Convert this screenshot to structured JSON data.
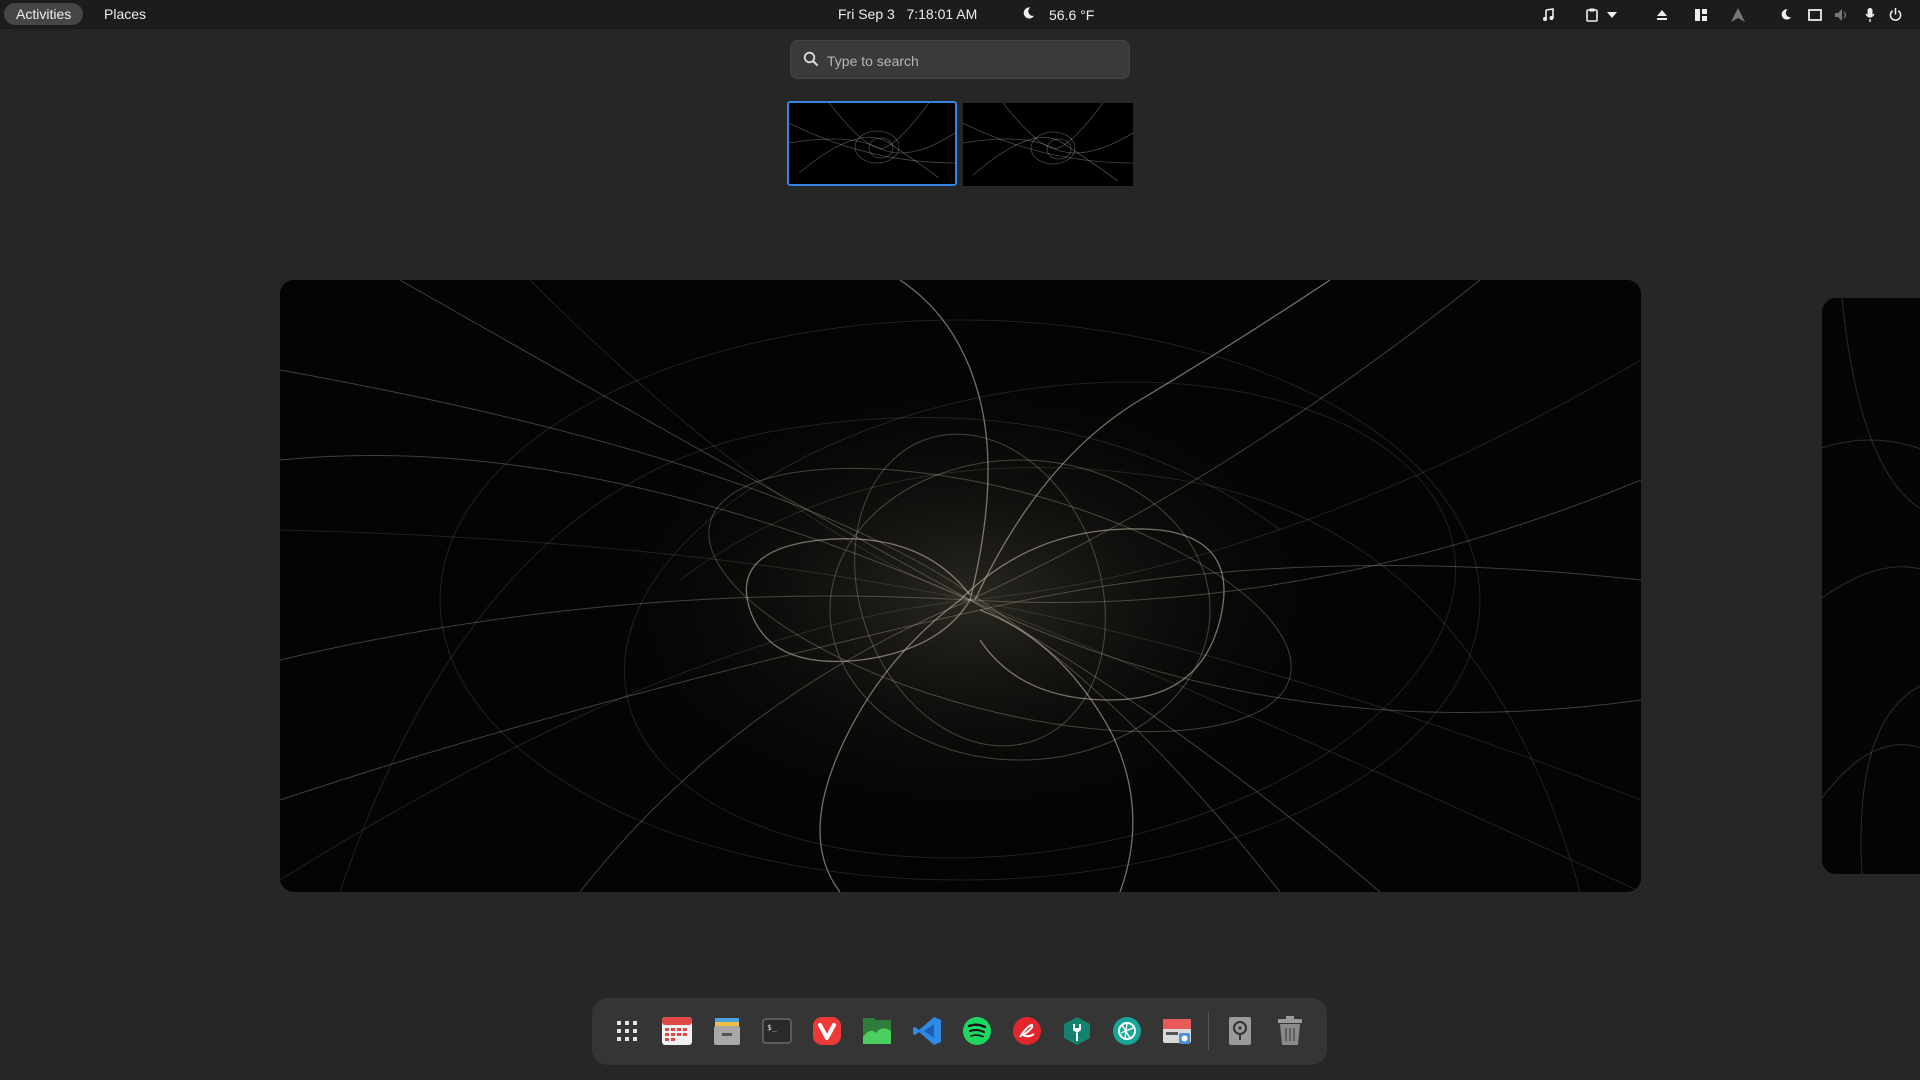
{
  "topbar": {
    "activities_label": "Activities",
    "places_label": "Places",
    "clock": "Fri Sep 3   7:18:01 AM",
    "weather_temp": "56.6 °F",
    "weather_icon": "moon-icon",
    "tray_icons": [
      "music-note-icon",
      "clipboard-icon",
      "dropdown-arrow-icon",
      "eject-icon",
      "grid-layout-icon",
      "arch-logo-icon",
      "night-light-icon",
      "screen-icon",
      "volume-muted-icon",
      "microphone-icon",
      "power-icon"
    ]
  },
  "search": {
    "placeholder": "Type to search"
  },
  "workspaces": {
    "active_index": 0,
    "count": 2,
    "accent": "#3584e4"
  },
  "dash": {
    "apps": [
      {
        "name": "show-apps-icon",
        "color": "#e6e6e6"
      },
      {
        "name": "calendar-app-icon",
        "color": "#e04848"
      },
      {
        "name": "file-manager-icon",
        "color": "#a8a8a8"
      },
      {
        "name": "terminal-icon",
        "color": "#2a2a2a"
      },
      {
        "name": "vivaldi-browser-icon",
        "color": "#ef3939"
      },
      {
        "name": "image-viewer-icon",
        "color": "#3bb54a"
      },
      {
        "name": "vscode-icon",
        "color": "#2f8ae6"
      },
      {
        "name": "spotify-icon",
        "color": "#1ed760"
      },
      {
        "name": "acrobat-icon",
        "color": "#e3262d"
      },
      {
        "name": "dev-tools-icon",
        "color": "#14806e"
      },
      {
        "name": "aperture-app-icon",
        "color": "#18a698"
      },
      {
        "name": "screenshot-app-icon",
        "color": "#e85a5a"
      },
      {
        "name": "disk-icon",
        "color": "#9a9a9a"
      },
      {
        "name": "trash-icon",
        "color": "#9a9a9a"
      }
    ]
  }
}
